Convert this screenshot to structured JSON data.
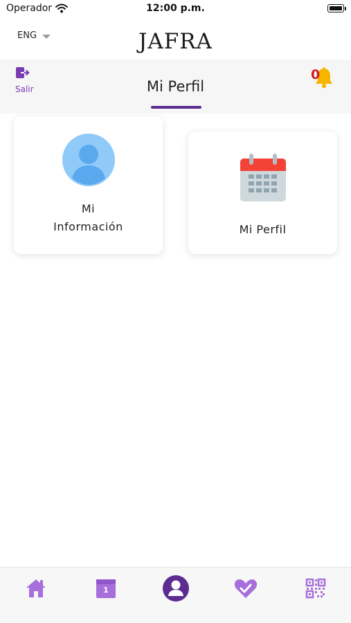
{
  "status_bar": {
    "carrier": "Operador",
    "time": "12:00 p.m."
  },
  "top_bar": {
    "language": "ENG",
    "logo_text": "JAFRA"
  },
  "header": {
    "exit_label": "Salir",
    "title": "Mi Perfil",
    "notification_count": "0"
  },
  "cards": [
    {
      "label_line1": "Mi",
      "label_line2": "Información",
      "icon": "user-avatar-icon"
    },
    {
      "label": "Mi Perfil",
      "icon": "calendar-icon"
    }
  ],
  "tab_bar": {
    "items": [
      {
        "icon": "home-icon",
        "active": false
      },
      {
        "icon": "calendar-icon",
        "text": "1",
        "active": false
      },
      {
        "icon": "profile-icon",
        "active": true
      },
      {
        "icon": "heart-check-icon",
        "active": false
      },
      {
        "icon": "qr-code-icon",
        "active": false
      }
    ]
  },
  "colors": {
    "accent_purple": "#5c2c91",
    "icon_purple": "#a66fdc",
    "exit_purple": "#7a3bb2",
    "bell": "#f7b500",
    "badge_red": "#cc1e1e",
    "avatar_blue": "#90caf9"
  }
}
